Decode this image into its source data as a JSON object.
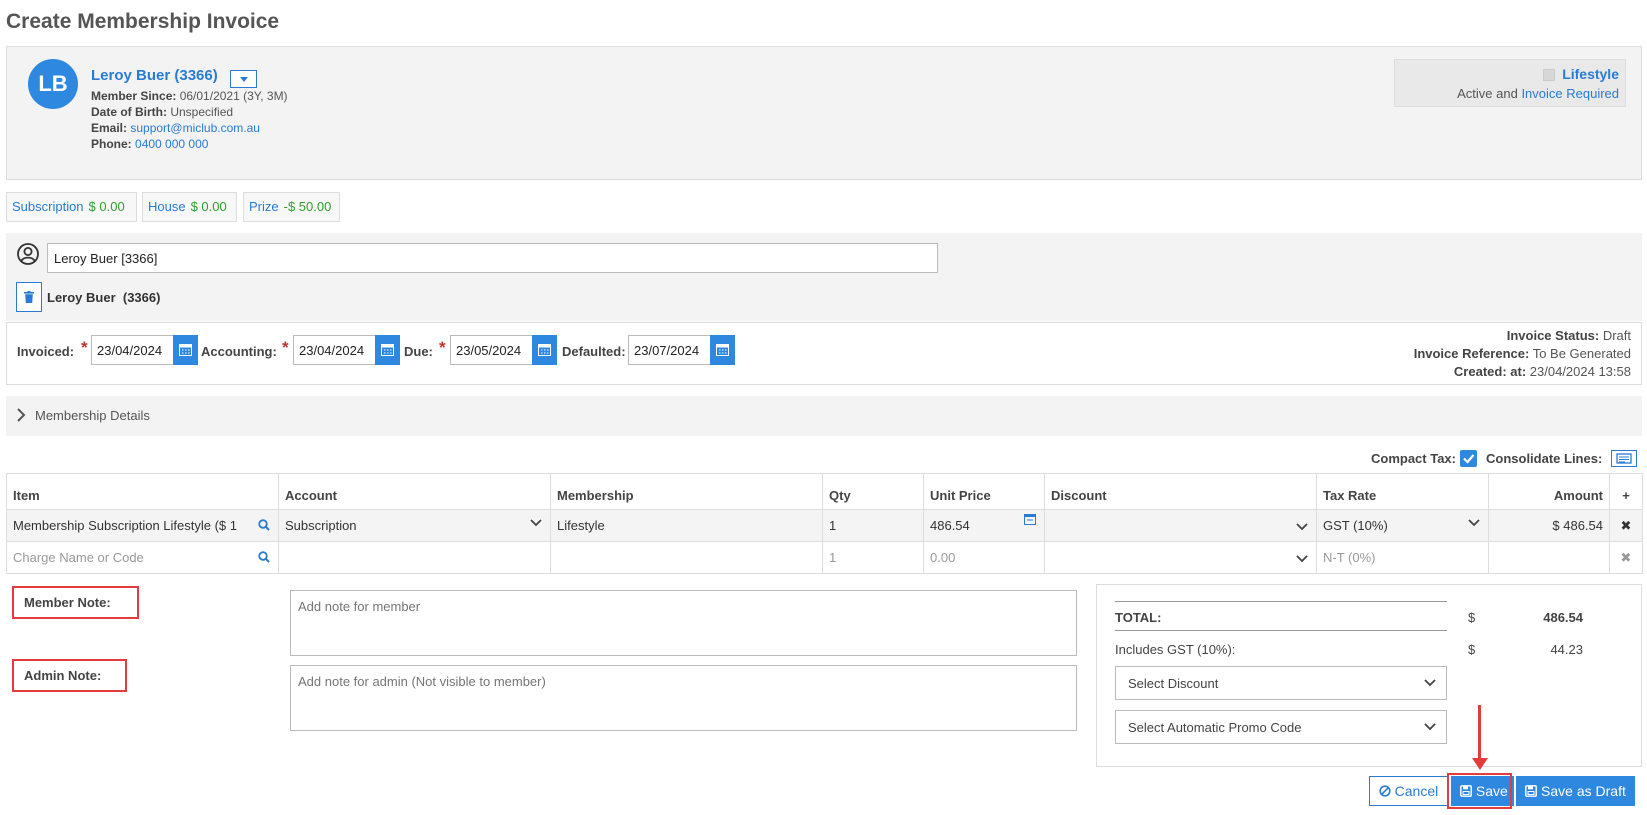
{
  "page": {
    "title": "Create Membership Invoice"
  },
  "member": {
    "initials": "LB",
    "name": "Leroy Buer (3366)",
    "member_since_label": "Member Since:",
    "member_since": "06/01/2021 (3Y, 3M)",
    "dob_label": "Date of Birth:",
    "dob": "Unspecified",
    "email_label": "Email:",
    "email": "support@miclub.com.au",
    "phone_label": "Phone:",
    "phone": "0400 000 000"
  },
  "membership_badge": {
    "name": "Lifestyle",
    "status_prefix": "Active and",
    "status_link": "Invoice Required"
  },
  "balances": [
    {
      "label": "Subscription",
      "value": "$ 0.00"
    },
    {
      "label": "House",
      "value": "$ 0.00"
    },
    {
      "label": "Prize",
      "value": "-$ 50.00"
    }
  ],
  "member_select": {
    "input_value": "Leroy Buer [3366]",
    "selected_name": "Leroy Buer",
    "selected_id": "(3366)"
  },
  "dates": {
    "invoiced_label": "Invoiced:",
    "invoiced": "23/04/2024",
    "accounting_label": "Accounting:",
    "accounting": "23/04/2024",
    "due_label": "Due:",
    "due": "23/05/2024",
    "defaulted_label": "Defaulted:",
    "defaulted": "23/07/2024",
    "required_mark": "*"
  },
  "invoice_meta": {
    "status_label": "Invoice Status:",
    "status": "Draft",
    "reference_label": "Invoice Reference:",
    "reference": "To Be Generated",
    "created_label": "Created:  at:",
    "created": "23/04/2024 13:58"
  },
  "membership_details": {
    "label": "Membership Details"
  },
  "options": {
    "compact_tax_label": "Compact Tax:",
    "consolidate_label": "Consolidate Lines:"
  },
  "table": {
    "headers": [
      "Item",
      "Account",
      "Membership",
      "Qty",
      "Unit Price",
      "Discount",
      "Tax Rate",
      "Amount"
    ],
    "rows": [
      {
        "item": "Membership Subscription Lifestyle ($ 1",
        "account": "Subscription",
        "membership": "Lifestyle",
        "qty": "1",
        "unit_price": "486.54",
        "discount": "",
        "tax_rate": "GST (10%)",
        "amount": "$ 486.54"
      },
      {
        "item": "Charge Name or Code",
        "account": "",
        "membership": "",
        "qty": "1",
        "unit_price": "0.00",
        "discount": "",
        "tax_rate": "N-T (0%)",
        "amount": ""
      }
    ]
  },
  "notes": {
    "member_label": "Member Note:",
    "member_placeholder": "Add note for member",
    "admin_label": "Admin Note:",
    "admin_placeholder": "Add note for admin (Not visible to member)"
  },
  "totals": {
    "total_label": "TOTAL:",
    "currency": "$",
    "total": "486.54",
    "gst_label": "Includes GST (10%):",
    "gst": "44.23",
    "discount_select": "Select Discount",
    "promo_select": "Select Automatic Promo Code"
  },
  "buttons": {
    "cancel": "Cancel",
    "save": "Save",
    "save_draft": "Save as Draft"
  },
  "colors": {
    "accent": "#2f88e0",
    "link": "#2a7bd4",
    "positive": "#2ea12e",
    "highlight": "#e43c3c"
  }
}
